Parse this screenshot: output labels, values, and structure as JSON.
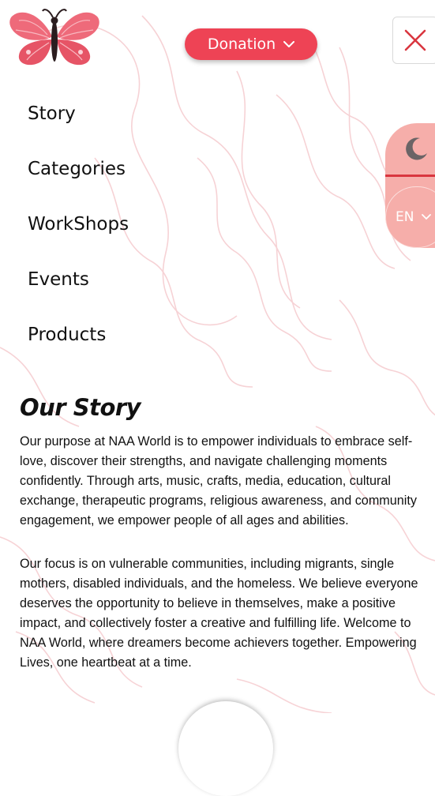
{
  "header": {
    "donation_label": "Donation",
    "logo_icon": "butterfly-logo-icon",
    "close_icon": "close-icon",
    "dropdown_icon": "chevron-down-icon"
  },
  "nav": {
    "items": [
      {
        "label": "Story"
      },
      {
        "label": "Categories"
      },
      {
        "label": "WorkShops"
      },
      {
        "label": "Events"
      },
      {
        "label": "Products"
      }
    ]
  },
  "side_toggle": {
    "theme_icon": "moon-icon",
    "language": "EN",
    "language_icon": "chevron-down-icon"
  },
  "story": {
    "title": "Our Story",
    "paragraphs": [
      "Our purpose at NAA World is to empower individuals to embrace self-love, discover their strengths, and navigate challenging moments confidently. Through arts, music, crafts, media, education, cultural exchange, therapeutic programs, religious awareness, and community engagement, we empower people of all ages and abilities.",
      "Our focus is on vulnerable communities, including migrants, single mothers, disabled individuals, and the homeless. We believe everyone deserves the opportunity to believe in themselves, make a positive impact, and collectively foster a creative and fulfilling life. Welcome to NAA World, where dreamers become achievers together. Empowering Lives, one heartbeat at a time."
    ]
  },
  "colors": {
    "accent": "#ee4355",
    "close": "#d9363f",
    "toggle_bg": "#f6aeaa",
    "moon": "#6b6466"
  }
}
